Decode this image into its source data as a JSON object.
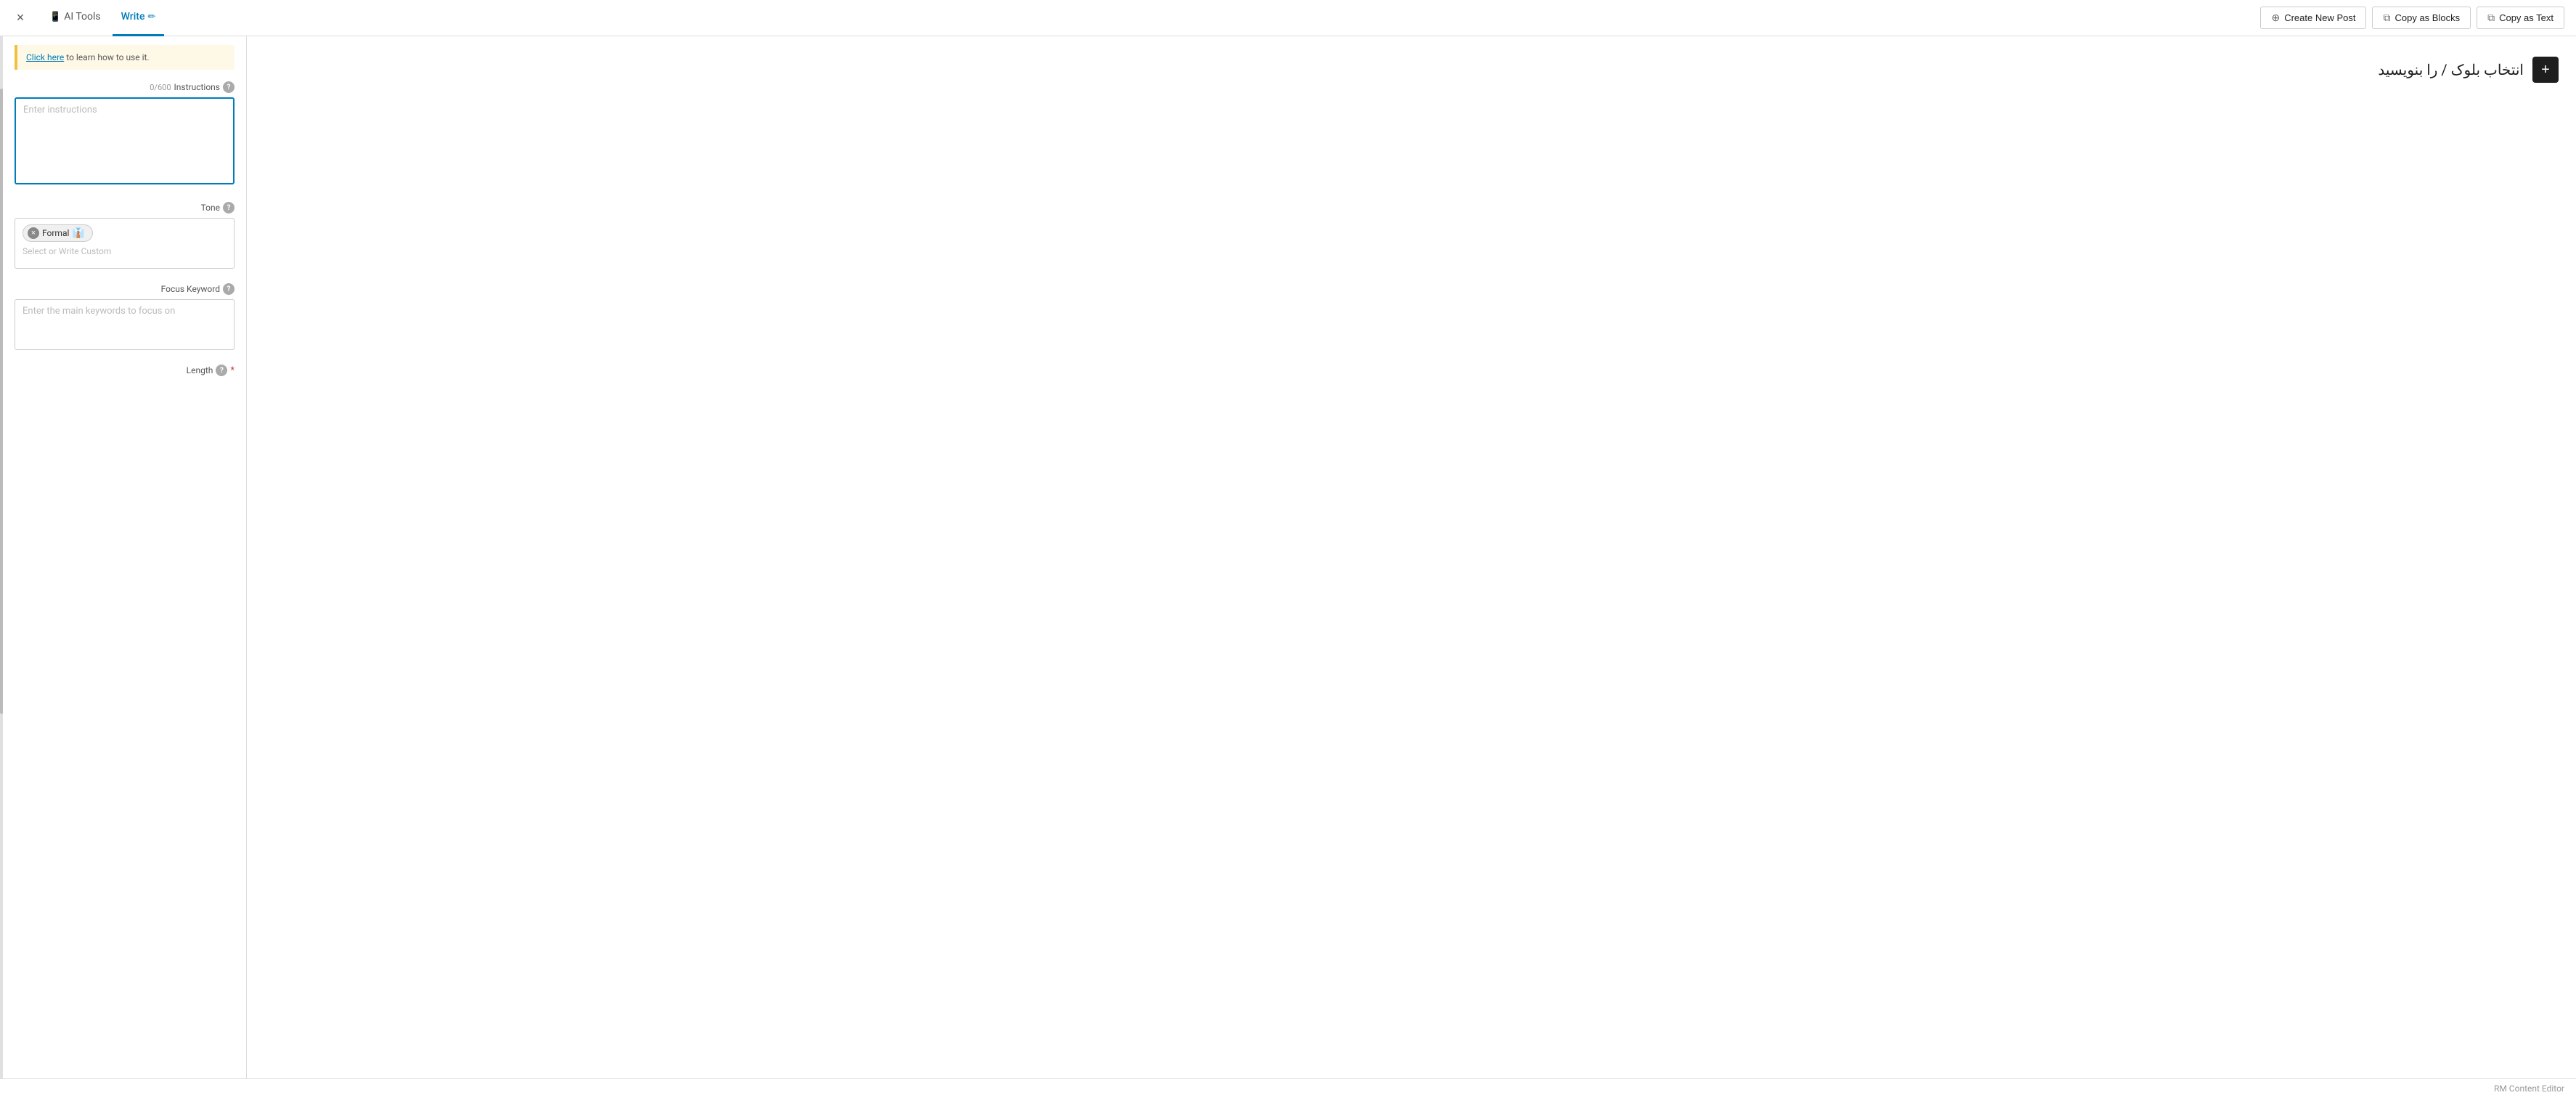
{
  "topBar": {
    "closeIcon": "×",
    "tabs": [
      {
        "id": "ai-tools",
        "label": "AI Tools",
        "icon": "🤖",
        "active": false
      },
      {
        "id": "write",
        "label": "Write",
        "icon": "✏️",
        "active": true
      }
    ],
    "actions": [
      {
        "id": "create-new-post",
        "label": "Create New Post",
        "icon": "+"
      },
      {
        "id": "copy-as-blocks",
        "label": "Copy as Blocks",
        "icon": "⧉"
      },
      {
        "id": "copy-as-text",
        "label": "Copy as Text",
        "icon": "⧉"
      }
    ]
  },
  "leftPanel": {
    "infoBanner": {
      "linkText": "Click here",
      "text": " to learn how to use it."
    },
    "instructionsSection": {
      "label": "Instructions",
      "counter": "0/600",
      "placeholder": "Enter instructions"
    },
    "toneSection": {
      "label": "Tone",
      "selectedTone": "Formal",
      "toneEmoji": "👔",
      "placeholder": "Select or Write Custom"
    },
    "focusKeywordSection": {
      "label": "Focus Keyword",
      "placeholder": "Enter the main keywords to focus on"
    },
    "lengthSection": {
      "label": "Length",
      "required": true
    }
  },
  "rightPanel": {
    "blockSelectorText": "انتخاب بلوک / را بنویسید",
    "addButtonLabel": "+"
  },
  "statusBar": {
    "text": "RM Content Editor"
  }
}
